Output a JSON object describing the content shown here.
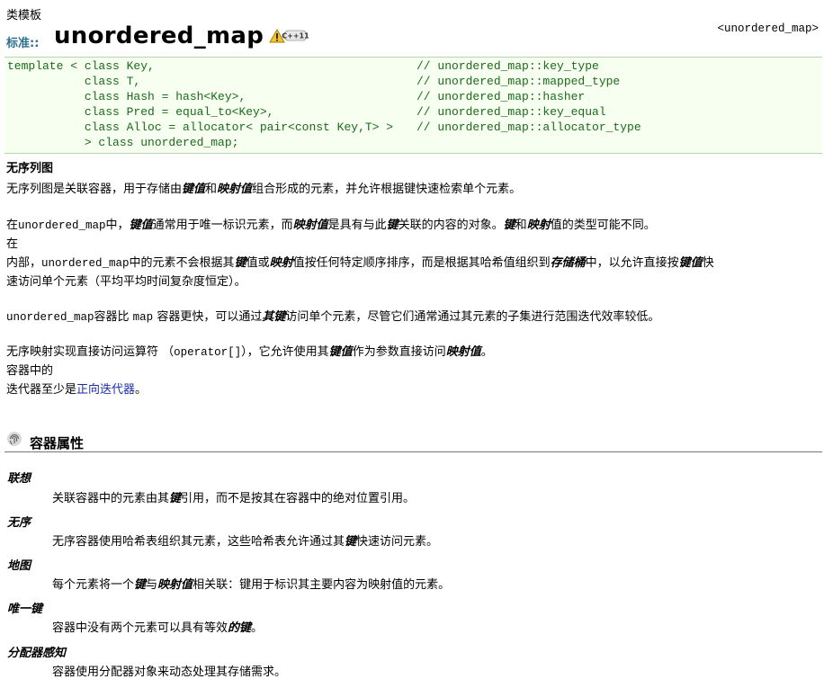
{
  "header": {
    "category": "类模板",
    "std_label": "标准::",
    "title": "unordered_map",
    "header_tag": "<unordered_map>"
  },
  "code": {
    "lines": [
      {
        "decl": "template < class Key,",
        "comment": "// unordered_map::key_type"
      },
      {
        "decl": "           class T,",
        "comment": "// unordered_map::mapped_type"
      },
      {
        "decl": "           class Hash = hash<Key>,",
        "comment": "// unordered_map::hasher"
      },
      {
        "decl": "           class Pred = equal_to<Key>,",
        "comment": "// unordered_map::key_equal"
      },
      {
        "decl": "           class Alloc = allocator< pair<const Key,T> >",
        "comment": "// unordered_map::allocator_type"
      },
      {
        "decl": "           > class unordered_map;",
        "comment": ""
      }
    ]
  },
  "intro": {
    "heading": "无序列图",
    "p1": {
      "a": "无序列图是关联容器，用于存储由",
      "b": "键值",
      "c": "和",
      "d": "映射值",
      "e": "组合形成的元素，并允许根据键快速检索单个元素。"
    },
    "p2": {
      "a": "在",
      "code": "unordered_map",
      "b": "中，",
      "c": "键值",
      "d": "通常用于唯一标识元素，而",
      "e": "映射值",
      "f": "是具有与此",
      "g": "键",
      "h": "关联的内容的对象。",
      "i": "键",
      "j": "和",
      "k": "映射",
      "l": "值的类型可能不同。"
    },
    "p2b": "在",
    "p3": {
      "a": "内部，",
      "code": "unordered_map",
      "b": "中的元素不会根据其",
      "c": "键",
      "d": "值或",
      "e": "映射",
      "f": "值按任何特定顺序排序，而是根据其哈希值组织到",
      "g": "存储桶",
      "h": "中，以允许直接按",
      "i": "键值",
      "j": "快"
    },
    "p3b": "速访问单个元素（平均平均时间复杂度恒定）。",
    "p4": {
      "code1": "unordered_map",
      "a": "容器比 ",
      "code2": "map",
      "b": " 容器更快，可以通过",
      "c": "其键",
      "d": "访问单个元素，尽管它们通常通过其元素的子集进行范围迭代效率较低。"
    },
    "p5": {
      "a": "无序映射实现直接访问运算符 （",
      "code": "operator[]",
      "b": "），它允许使用其",
      "c": "键值",
      "d": "作为参数直接访问",
      "e": "映射值",
      "f": "。"
    },
    "p5b": "容器中的",
    "p6": {
      "a": "迭代器至少是",
      "link": "正向迭代器",
      "b": "。"
    }
  },
  "properties": {
    "title": "容器属性",
    "icon": "fingerprint-icon",
    "items": [
      {
        "term": "联想",
        "desc": {
          "a": "关联容器中的元素由其",
          "b": "键",
          "c": "引用，而不是按其在容器中的绝对位置引用。"
        }
      },
      {
        "term": "无序",
        "desc": {
          "a": "无序容器使用哈希表组织其元素，这些哈希表允许通过其",
          "b": "键",
          "c": "快速访问元素。"
        }
      },
      {
        "term": "地图",
        "desc": {
          "a": "每个元素将一个",
          "b": "键",
          "c": "与",
          "d": "映射值",
          "e": "相关联：键用于标识其主要内容为映射值的元素。"
        }
      },
      {
        "term": "唯一键",
        "desc": {
          "a": "容器中没有两个元素可以具有等效",
          "b": "的键",
          "c": "。"
        }
      },
      {
        "term": "分配器感知",
        "desc": {
          "a": "容器使用分配器对象来动态处理其存储需求。",
          "b": "",
          "c": ""
        }
      }
    ]
  },
  "colors": {
    "link": "#1a2ea8",
    "code_bg": "#f7fff0",
    "code_text": "#1a6b1a",
    "std_label": "#2f6f8f"
  }
}
